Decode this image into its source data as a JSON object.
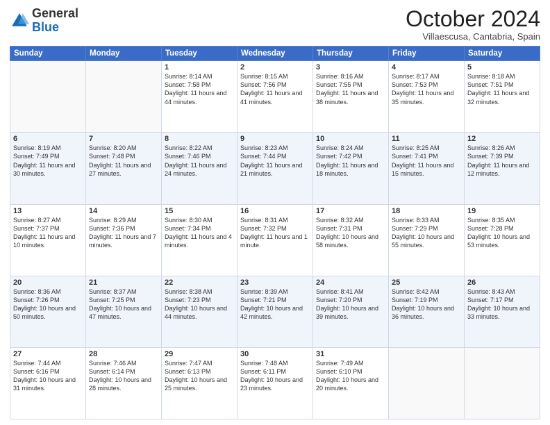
{
  "logo": {
    "general": "General",
    "blue": "Blue"
  },
  "header": {
    "month": "October 2024",
    "location": "Villaescusa, Cantabria, Spain"
  },
  "weekdays": [
    "Sunday",
    "Monday",
    "Tuesday",
    "Wednesday",
    "Thursday",
    "Friday",
    "Saturday"
  ],
  "weeks": [
    [
      {
        "day": "",
        "info": ""
      },
      {
        "day": "",
        "info": ""
      },
      {
        "day": "1",
        "info": "Sunrise: 8:14 AM\nSunset: 7:58 PM\nDaylight: 11 hours and 44 minutes."
      },
      {
        "day": "2",
        "info": "Sunrise: 8:15 AM\nSunset: 7:56 PM\nDaylight: 11 hours and 41 minutes."
      },
      {
        "day": "3",
        "info": "Sunrise: 8:16 AM\nSunset: 7:55 PM\nDaylight: 11 hours and 38 minutes."
      },
      {
        "day": "4",
        "info": "Sunrise: 8:17 AM\nSunset: 7:53 PM\nDaylight: 11 hours and 35 minutes."
      },
      {
        "day": "5",
        "info": "Sunrise: 8:18 AM\nSunset: 7:51 PM\nDaylight: 11 hours and 32 minutes."
      }
    ],
    [
      {
        "day": "6",
        "info": "Sunrise: 8:19 AM\nSunset: 7:49 PM\nDaylight: 11 hours and 30 minutes."
      },
      {
        "day": "7",
        "info": "Sunrise: 8:20 AM\nSunset: 7:48 PM\nDaylight: 11 hours and 27 minutes."
      },
      {
        "day": "8",
        "info": "Sunrise: 8:22 AM\nSunset: 7:46 PM\nDaylight: 11 hours and 24 minutes."
      },
      {
        "day": "9",
        "info": "Sunrise: 8:23 AM\nSunset: 7:44 PM\nDaylight: 11 hours and 21 minutes."
      },
      {
        "day": "10",
        "info": "Sunrise: 8:24 AM\nSunset: 7:42 PM\nDaylight: 11 hours and 18 minutes."
      },
      {
        "day": "11",
        "info": "Sunrise: 8:25 AM\nSunset: 7:41 PM\nDaylight: 11 hours and 15 minutes."
      },
      {
        "day": "12",
        "info": "Sunrise: 8:26 AM\nSunset: 7:39 PM\nDaylight: 11 hours and 12 minutes."
      }
    ],
    [
      {
        "day": "13",
        "info": "Sunrise: 8:27 AM\nSunset: 7:37 PM\nDaylight: 11 hours and 10 minutes."
      },
      {
        "day": "14",
        "info": "Sunrise: 8:29 AM\nSunset: 7:36 PM\nDaylight: 11 hours and 7 minutes."
      },
      {
        "day": "15",
        "info": "Sunrise: 8:30 AM\nSunset: 7:34 PM\nDaylight: 11 hours and 4 minutes."
      },
      {
        "day": "16",
        "info": "Sunrise: 8:31 AM\nSunset: 7:32 PM\nDaylight: 11 hours and 1 minute."
      },
      {
        "day": "17",
        "info": "Sunrise: 8:32 AM\nSunset: 7:31 PM\nDaylight: 10 hours and 58 minutes."
      },
      {
        "day": "18",
        "info": "Sunrise: 8:33 AM\nSunset: 7:29 PM\nDaylight: 10 hours and 55 minutes."
      },
      {
        "day": "19",
        "info": "Sunrise: 8:35 AM\nSunset: 7:28 PM\nDaylight: 10 hours and 53 minutes."
      }
    ],
    [
      {
        "day": "20",
        "info": "Sunrise: 8:36 AM\nSunset: 7:26 PM\nDaylight: 10 hours and 50 minutes."
      },
      {
        "day": "21",
        "info": "Sunrise: 8:37 AM\nSunset: 7:25 PM\nDaylight: 10 hours and 47 minutes."
      },
      {
        "day": "22",
        "info": "Sunrise: 8:38 AM\nSunset: 7:23 PM\nDaylight: 10 hours and 44 minutes."
      },
      {
        "day": "23",
        "info": "Sunrise: 8:39 AM\nSunset: 7:21 PM\nDaylight: 10 hours and 42 minutes."
      },
      {
        "day": "24",
        "info": "Sunrise: 8:41 AM\nSunset: 7:20 PM\nDaylight: 10 hours and 39 minutes."
      },
      {
        "day": "25",
        "info": "Sunrise: 8:42 AM\nSunset: 7:19 PM\nDaylight: 10 hours and 36 minutes."
      },
      {
        "day": "26",
        "info": "Sunrise: 8:43 AM\nSunset: 7:17 PM\nDaylight: 10 hours and 33 minutes."
      }
    ],
    [
      {
        "day": "27",
        "info": "Sunrise: 7:44 AM\nSunset: 6:16 PM\nDaylight: 10 hours and 31 minutes."
      },
      {
        "day": "28",
        "info": "Sunrise: 7:46 AM\nSunset: 6:14 PM\nDaylight: 10 hours and 28 minutes."
      },
      {
        "day": "29",
        "info": "Sunrise: 7:47 AM\nSunset: 6:13 PM\nDaylight: 10 hours and 25 minutes."
      },
      {
        "day": "30",
        "info": "Sunrise: 7:48 AM\nSunset: 6:11 PM\nDaylight: 10 hours and 23 minutes."
      },
      {
        "day": "31",
        "info": "Sunrise: 7:49 AM\nSunset: 6:10 PM\nDaylight: 10 hours and 20 minutes."
      },
      {
        "day": "",
        "info": ""
      },
      {
        "day": "",
        "info": ""
      }
    ]
  ]
}
